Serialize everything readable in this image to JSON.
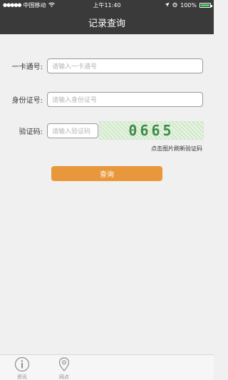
{
  "statusbar": {
    "signal_icon": "signal-dots-icon",
    "carrier": "中国移动",
    "wifi_icon": "wifi-icon",
    "time": "上午11:40",
    "location_icon": "location-arrow-icon",
    "alarm_icon": "alarm-icon",
    "battery_text": "100%",
    "battery_icon": "battery-icon"
  },
  "navbar": {
    "title": "记录查询"
  },
  "form": {
    "card_label": "一卡通号:",
    "card_placeholder": "请输入一卡通号",
    "id_label": "身份证号:",
    "id_placeholder": "请输入身份证号",
    "captcha_label": "验证码:",
    "captcha_placeholder": "请输入验证码",
    "captcha_text": "0665",
    "refresh_hint": "点击图片刷新验证码",
    "submit_label": "查询"
  },
  "tabbar": {
    "tabs": [
      {
        "label": "资讯",
        "icon": "info-circle-icon"
      },
      {
        "label": "网点",
        "icon": "map-pin-icon"
      }
    ]
  },
  "colors": {
    "header_bg": "#3a3a3a",
    "button_bg": "#e8973a",
    "captcha_text": "#3f8a4a",
    "page_bg": "#f0f0f0"
  }
}
